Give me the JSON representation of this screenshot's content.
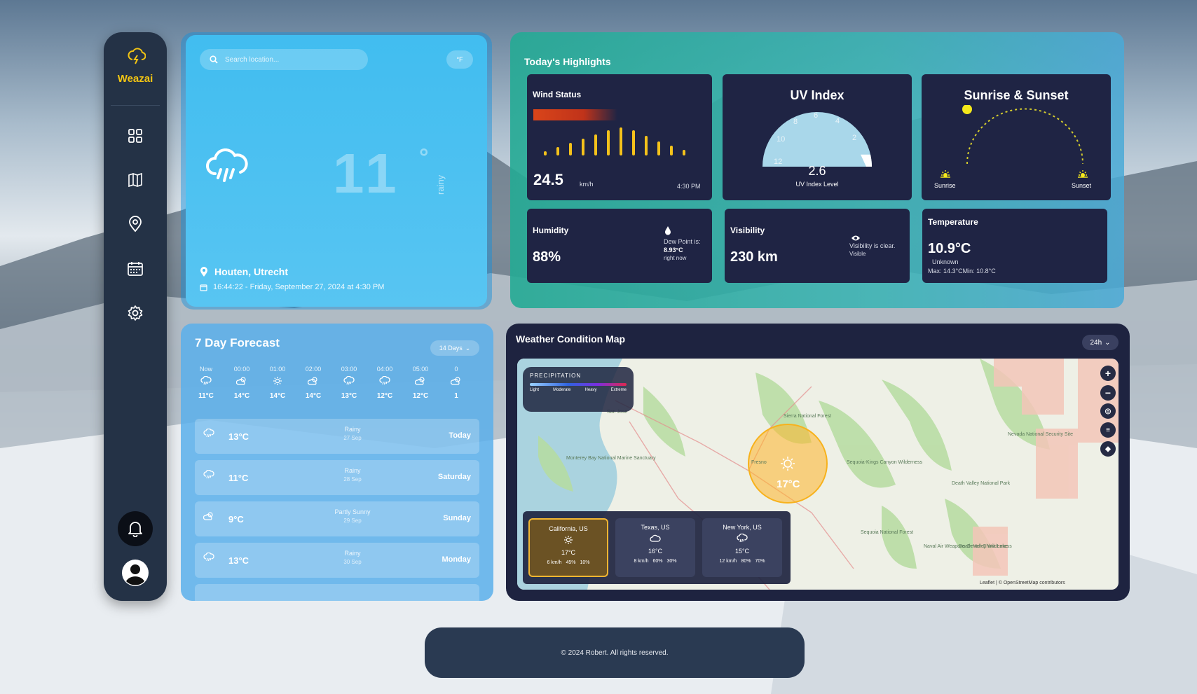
{
  "app": {
    "name": "Weazai"
  },
  "colors": {
    "accent": "#f2c413",
    "sidebar": "#243246",
    "tile": "#1f2444"
  },
  "sidebar": {
    "items": [
      {
        "icon": "grid-icon"
      },
      {
        "icon": "map-icon"
      },
      {
        "icon": "location-pin-icon"
      },
      {
        "icon": "calendar-icon"
      },
      {
        "icon": "gear-icon"
      }
    ]
  },
  "current": {
    "search_placeholder": "Search location...",
    "unit": "°F",
    "temp": "11",
    "deg": "°",
    "condition": "rainy",
    "location": "Houten, Utrecht",
    "datetime": "16:44:22 - Friday, September 27, 2024 at 4:30 PM"
  },
  "highlights": {
    "title": "Today's Highlights",
    "wind": {
      "label": "Wind Status",
      "value": "24.5",
      "unit": "km/h",
      "time": "4:30 PM",
      "bar_values": [
        0.15,
        0.3,
        0.45,
        0.6,
        0.75,
        0.9,
        1.0,
        0.9,
        0.7,
        0.5,
        0.35,
        0.2
      ]
    },
    "uv": {
      "label": "UV Index",
      "value": "2.6",
      "level_label": "UV Index Level",
      "ticks": [
        "12",
        "10",
        "8",
        "6",
        "4",
        "2"
      ],
      "fraction": 0.22
    },
    "sun": {
      "label": "Sunrise & Sunset",
      "sunrise": "Sunrise",
      "sunset": "Sunset"
    },
    "humidity": {
      "label": "Humidity",
      "value": "88%",
      "dew_label": "Dew Point is:",
      "dew_value": "8.93°C",
      "dew_note": "right now"
    },
    "visibility": {
      "label": "Visibility",
      "value": "230 km",
      "note": "Visibility is clear.",
      "note2": "Visible"
    },
    "temperature": {
      "label": "Temperature",
      "value": "10.9°C",
      "note": "Unknown",
      "range": "Max: 14.3°CMin: 10.8°C"
    }
  },
  "forecast": {
    "title": "7 Day Forecast",
    "range_label": "14 Days",
    "hourly": [
      {
        "time": "Now",
        "icon": "rain-cloud-icon",
        "temp": "11°C"
      },
      {
        "time": "00:00",
        "icon": "partly-cloudy-icon",
        "temp": "14°C"
      },
      {
        "time": "01:00",
        "icon": "sun-icon",
        "temp": "14°C"
      },
      {
        "time": "02:00",
        "icon": "partly-cloudy-icon",
        "temp": "14°C"
      },
      {
        "time": "03:00",
        "icon": "rain-cloud-icon",
        "temp": "13°C"
      },
      {
        "time": "04:00",
        "icon": "rain-cloud-icon",
        "temp": "12°C"
      },
      {
        "time": "05:00",
        "icon": "partly-cloudy-icon",
        "temp": "12°C"
      },
      {
        "time": "0",
        "icon": "partly-cloudy-icon",
        "temp": "1"
      }
    ],
    "days": [
      {
        "temp": "13°C",
        "cond": "Rainy",
        "date": "27 Sep",
        "day": "Today",
        "icon": "rain-cloud-icon"
      },
      {
        "temp": "11°C",
        "cond": "Rainy",
        "date": "28 Sep",
        "day": "Saturday",
        "icon": "rain-cloud-icon"
      },
      {
        "temp": "9°C",
        "cond": "Partly Sunny",
        "date": "29 Sep",
        "day": "Sunday",
        "icon": "partly-cloudy-icon"
      },
      {
        "temp": "13°C",
        "cond": "Rainy",
        "date": "30 Sep",
        "day": "Monday",
        "icon": "rain-cloud-icon"
      }
    ]
  },
  "map": {
    "title": "Weather Condition Map",
    "range_label": "24h",
    "legend_title": "PRECIPITATION",
    "legend_items": [
      "Light",
      "Moderate",
      "Heavy",
      "Extreme"
    ],
    "marker_temp": "17°C",
    "cities": [
      {
        "name": "California, US",
        "temp": "17°C",
        "wind": "6 km/h",
        "humidity": "45%",
        "precip": "10%",
        "icon": "sun-icon"
      },
      {
        "name": "Texas, US",
        "temp": "16°C",
        "wind": "8 km/h",
        "humidity": "60%",
        "precip": "30%",
        "icon": "cloud-icon"
      },
      {
        "name": "New York, US",
        "temp": "15°C",
        "wind": "12 km/h",
        "humidity": "80%",
        "precip": "70%",
        "icon": "rain-cloud-icon"
      }
    ],
    "places": [
      "San Jose",
      "Monterey Bay National Marine Sanctuary",
      "Fresno",
      "Sierra National Forest",
      "Sequoia-Kings Canyon Wilderness",
      "Death Valley National Park",
      "Death Valley Wilderness",
      "Nevada National Security Site",
      "Sequoia National Forest",
      "Naval Air Weapons Center China Lake"
    ],
    "attribution": "Leaflet | © OpenStreetMap contributors"
  },
  "footer": {
    "text": "© 2024 Robert. All rights reserved."
  }
}
